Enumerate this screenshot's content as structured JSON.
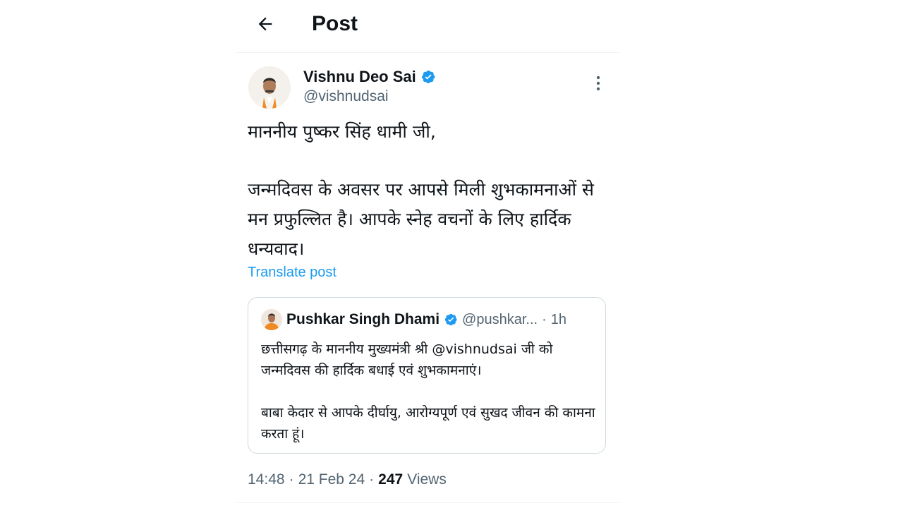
{
  "header": {
    "title": "Post",
    "back_icon": "arrow-left-icon"
  },
  "author": {
    "name": "Vishnu Deo Sai",
    "handle": "@vishnudsai",
    "verified": true,
    "verified_color": "#1d9bf0"
  },
  "tweet": {
    "paragraphs": [
      "माननीय पुष्कर सिंह धामी जी,",
      "जन्मदिवस के अवसर पर आपसे मिली शुभकामनाओं से मन प्रफुल्लित है। आपके स्नेह वचनों के लिए हार्दिक धन्यवाद।"
    ],
    "translate_label": "Translate post"
  },
  "quoted": {
    "name": "Pushkar Singh Dhami",
    "handle": "@pushkar...",
    "separator": "·",
    "time": "1h",
    "verified": true,
    "paragraphs": [
      "छत्तीसगढ़ के माननीय मुख्यमंत्री श्री @vishnudsai जी को जन्मदिवस की हार्दिक बधाई एवं शुभकामनाएं।",
      "बाबा केदार से आपके दीर्घायु, आरोग्यपूर्ण एवं सुखद जीवन की कामना करता हूं।"
    ]
  },
  "meta": {
    "time": "14:48",
    "sep1": "·",
    "date": "21 Feb 24",
    "sep2": "·",
    "views_count": "247",
    "views_label": "Views"
  },
  "colors": {
    "accent": "#1d9bf0",
    "text": "#0f1419",
    "muted": "#536471",
    "border": "#cfd9de"
  }
}
